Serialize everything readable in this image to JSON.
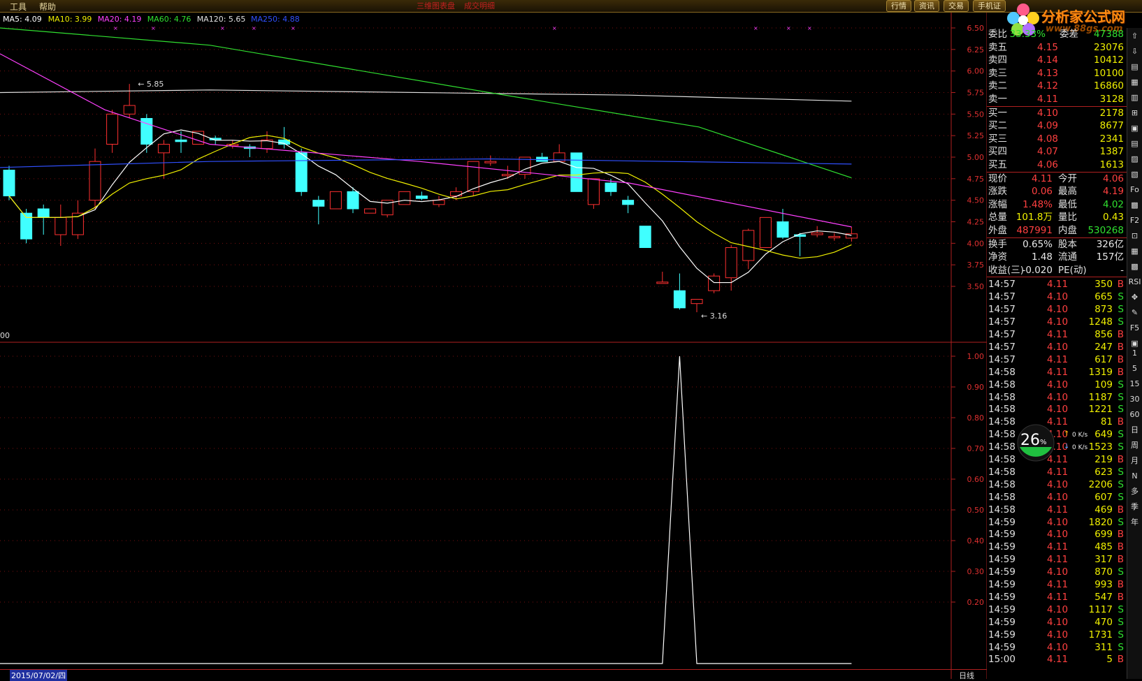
{
  "menu": {
    "tools": "工具",
    "help": "帮助",
    "red1": "三维图表盘",
    "red2": "成交明细"
  },
  "top_buttons": [
    "行情",
    "资讯",
    "交易",
    "手机证"
  ],
  "logo": {
    "title": "分析家公式网",
    "url": "www.88gs.com"
  },
  "ma_legend": [
    {
      "label": "MA5: 4.09",
      "color": "#ffffff"
    },
    {
      "label": "MA10: 3.99",
      "color": "#f0f000"
    },
    {
      "label": "MA20: 4.19",
      "color": "#ff40ff"
    },
    {
      "label": "MA60: 4.76",
      "color": "#30e030"
    },
    {
      "label": "MA120: 5.65",
      "color": "#e0e0e0"
    },
    {
      "label": "MA250: 4.88",
      "color": "#3050ff"
    }
  ],
  "price_axis": [
    "6.50",
    "6.25",
    "6.00",
    "5.75",
    "5.50",
    "5.25",
    "5.00",
    "4.75",
    "4.50",
    "4.25",
    "4.00",
    "3.75",
    "3.50"
  ],
  "indicator_axis": [
    "1.00",
    "0.90",
    "0.80",
    "0.70",
    "0.60",
    "0.50",
    "0.40",
    "0.30",
    "0.20"
  ],
  "indicator_label": "00",
  "annotations": {
    "high": "5.85",
    "low": "3.16"
  },
  "candles": [
    {
      "o": 4.85,
      "c": 4.55,
      "h": 4.9,
      "l": 4.5
    },
    {
      "o": 4.35,
      "c": 4.05,
      "h": 4.4,
      "l": 4.0
    },
    {
      "o": 4.4,
      "c": 4.3,
      "h": 4.45,
      "l": 4.1
    },
    {
      "o": 4.1,
      "c": 4.3,
      "h": 4.45,
      "l": 3.97
    },
    {
      "o": 4.1,
      "c": 4.35,
      "h": 4.5,
      "l": 4.05
    },
    {
      "o": 4.5,
      "c": 4.95,
      "h": 5.1,
      "l": 4.4
    },
    {
      "o": 5.15,
      "c": 5.5,
      "h": 5.55,
      "l": 5.05
    },
    {
      "o": 5.5,
      "c": 5.6,
      "h": 5.85,
      "l": 5.45
    },
    {
      "o": 5.45,
      "c": 5.15,
      "h": 5.5,
      "l": 5.05
    },
    {
      "o": 5.05,
      "c": 5.15,
      "h": 5.2,
      "l": 4.75
    },
    {
      "o": 5.2,
      "c": 5.18,
      "h": 5.3,
      "l": 5.05
    },
    {
      "o": 5.15,
      "c": 5.3,
      "h": 5.3,
      "l": 5.15
    },
    {
      "o": 5.22,
      "c": 5.2,
      "h": 5.25,
      "l": 5.15
    },
    {
      "o": 5.15,
      "c": 5.15,
      "h": 5.2,
      "l": 5.1
    },
    {
      "o": 5.12,
      "c": 5.1,
      "h": 5.15,
      "l": 5.0
    },
    {
      "o": 5.1,
      "c": 5.2,
      "h": 5.3,
      "l": 5.05
    },
    {
      "o": 5.2,
      "c": 5.15,
      "h": 5.35,
      "l": 5.1
    },
    {
      "o": 5.05,
      "c": 4.6,
      "h": 5.1,
      "l": 4.55
    },
    {
      "o": 4.5,
      "c": 4.43,
      "h": 4.55,
      "l": 4.22
    },
    {
      "o": 4.4,
      "c": 4.6,
      "h": 4.6,
      "l": 4.4
    },
    {
      "o": 4.6,
      "c": 4.4,
      "h": 4.65,
      "l": 4.35
    },
    {
      "o": 4.35,
      "c": 4.4,
      "h": 4.4,
      "l": 4.35
    },
    {
      "o": 4.33,
      "c": 4.5,
      "h": 4.5,
      "l": 4.3
    },
    {
      "o": 4.45,
      "c": 4.6,
      "h": 4.6,
      "l": 4.45
    },
    {
      "o": 4.55,
      "c": 4.52,
      "h": 4.6,
      "l": 4.5
    },
    {
      "o": 4.45,
      "c": 4.5,
      "h": 4.55,
      "l": 4.42
    },
    {
      "o": 4.55,
      "c": 4.6,
      "h": 4.65,
      "l": 4.5
    },
    {
      "o": 4.6,
      "c": 4.95,
      "h": 4.95,
      "l": 4.55
    },
    {
      "o": 4.95,
      "c": 4.95,
      "h": 5.02,
      "l": 4.9
    },
    {
      "o": 4.8,
      "c": 4.8,
      "h": 4.9,
      "l": 4.75
    },
    {
      "o": 4.8,
      "c": 5.0,
      "h": 5.0,
      "l": 4.75
    },
    {
      "o": 5.0,
      "c": 4.95,
      "h": 5.05,
      "l": 4.95
    },
    {
      "o": 4.95,
      "c": 5.05,
      "h": 5.15,
      "l": 4.95
    },
    {
      "o": 5.05,
      "c": 4.6,
      "h": 5.05,
      "l": 4.6
    },
    {
      "o": 4.45,
      "c": 4.75,
      "h": 4.75,
      "l": 4.4
    },
    {
      "o": 4.7,
      "c": 4.6,
      "h": 4.75,
      "l": 4.55
    },
    {
      "o": 4.5,
      "c": 4.45,
      "h": 4.55,
      "l": 4.35
    },
    {
      "o": 4.2,
      "c": 3.95,
      "h": 4.2,
      "l": 3.95
    },
    {
      "o": 3.55,
      "c": 3.55,
      "h": 3.67,
      "l": 3.55
    },
    {
      "o": 3.45,
      "c": 3.25,
      "h": 3.65,
      "l": 3.23
    },
    {
      "o": 3.3,
      "c": 3.35,
      "h": 3.35,
      "l": 3.2
    },
    {
      "o": 3.45,
      "c": 3.62,
      "h": 3.65,
      "l": 3.42
    },
    {
      "o": 3.6,
      "c": 3.95,
      "h": 3.98,
      "l": 3.45
    },
    {
      "o": 3.8,
      "c": 4.15,
      "h": 4.17,
      "l": 3.7
    },
    {
      "o": 3.95,
      "c": 4.3,
      "h": 4.3,
      "l": 3.95
    },
    {
      "o": 4.25,
      "c": 4.07,
      "h": 4.4,
      "l": 4.05
    },
    {
      "o": 4.1,
      "c": 4.08,
      "h": 4.12,
      "l": 3.85
    },
    {
      "o": 4.1,
      "c": 4.12,
      "h": 4.2,
      "l": 4.07
    },
    {
      "o": 4.08,
      "c": 4.08,
      "h": 4.12,
      "l": 4.03
    },
    {
      "o": 4.06,
      "c": 4.11,
      "h": 4.19,
      "l": 4.02
    }
  ],
  "indicator_series": {
    "zero_before": 38,
    "spike_index": 39,
    "value": 1.0
  },
  "quote": {
    "committee": {
      "label1": "委比",
      "value1": "33.33%",
      "label2": "委差",
      "value2": "47388"
    },
    "sells": [
      {
        "label": "卖五",
        "price": "4.15",
        "vol": "23076"
      },
      {
        "label": "卖四",
        "price": "4.14",
        "vol": "10412"
      },
      {
        "label": "卖三",
        "price": "4.13",
        "vol": "10100"
      },
      {
        "label": "卖二",
        "price": "4.12",
        "vol": "16860"
      },
      {
        "label": "卖一",
        "price": "4.11",
        "vol": "3128"
      }
    ],
    "buys": [
      {
        "label": "买一",
        "price": "4.10",
        "vol": "2178"
      },
      {
        "label": "买二",
        "price": "4.09",
        "vol": "8677"
      },
      {
        "label": "买三",
        "price": "4.08",
        "vol": "2341"
      },
      {
        "label": "买四",
        "price": "4.07",
        "vol": "1387"
      },
      {
        "label": "买五",
        "price": "4.06",
        "vol": "1613"
      }
    ],
    "stats": [
      {
        "l1": "现价",
        "v1": "4.11",
        "c1": "red",
        "l2": "今开",
        "v2": "4.06",
        "c2": "red"
      },
      {
        "l1": "涨跌",
        "v1": "0.06",
        "c1": "red",
        "l2": "最高",
        "v2": "4.19",
        "c2": "red"
      },
      {
        "l1": "涨幅",
        "v1": "1.48%",
        "c1": "red",
        "l2": "最低",
        "v2": "4.02",
        "c2": "green"
      },
      {
        "l1": "总量",
        "v1": "101.8万",
        "c1": "yellow",
        "l2": "量比",
        "v2": "0.43",
        "c2": "yellow"
      },
      {
        "l1": "外盘",
        "v1": "487991",
        "c1": "red",
        "l2": "内盘",
        "v2": "530268",
        "c2": "green"
      }
    ],
    "stats2": [
      {
        "l1": "换手",
        "v1": "0.65%",
        "l2": "股本",
        "v2": "326亿"
      },
      {
        "l1": "净资",
        "v1": "1.48",
        "l2": "流通",
        "v2": "157亿"
      },
      {
        "l1": "收益(三)",
        "v1": "-0.020",
        "l2": "PE(动)",
        "v2": "-"
      }
    ]
  },
  "ticks": [
    [
      "14:57",
      "4.11",
      "350",
      "B"
    ],
    [
      "14:57",
      "4.10",
      "665",
      "S"
    ],
    [
      "14:57",
      "4.10",
      "873",
      "S"
    ],
    [
      "14:57",
      "4.10",
      "1248",
      "S"
    ],
    [
      "14:57",
      "4.11",
      "856",
      "B"
    ],
    [
      "14:57",
      "4.10",
      "247",
      "B"
    ],
    [
      "14:57",
      "4.11",
      "617",
      "B"
    ],
    [
      "14:58",
      "4.11",
      "1319",
      "B"
    ],
    [
      "14:58",
      "4.10",
      "109",
      "S"
    ],
    [
      "14:58",
      "4.10",
      "1187",
      "S"
    ],
    [
      "14:58",
      "4.10",
      "1221",
      "S"
    ],
    [
      "14:58",
      "4.11",
      "81",
      "B"
    ],
    [
      "14:58",
      "4.10",
      "649",
      "S"
    ],
    [
      "14:58",
      "4.10",
      "1523",
      "S"
    ],
    [
      "14:58",
      "4.11",
      "219",
      "B"
    ],
    [
      "14:58",
      "4.11",
      "623",
      "S"
    ],
    [
      "14:58",
      "4.10",
      "2206",
      "S"
    ],
    [
      "14:58",
      "4.10",
      "607",
      "S"
    ],
    [
      "14:58",
      "4.11",
      "469",
      "B"
    ],
    [
      "14:59",
      "4.10",
      "1820",
      "S"
    ],
    [
      "14:59",
      "4.10",
      "699",
      "B"
    ],
    [
      "14:59",
      "4.11",
      "485",
      "B"
    ],
    [
      "14:59",
      "4.11",
      "317",
      "B"
    ],
    [
      "14:59",
      "4.10",
      "870",
      "S"
    ],
    [
      "14:59",
      "4.11",
      "993",
      "B"
    ],
    [
      "14:59",
      "4.11",
      "547",
      "B"
    ],
    [
      "14:59",
      "4.10",
      "1117",
      "S"
    ],
    [
      "14:59",
      "4.10",
      "470",
      "S"
    ],
    [
      "14:59",
      "4.10",
      "1731",
      "S"
    ],
    [
      "14:59",
      "4.10",
      "311",
      "S"
    ],
    [
      "15:00",
      "4.11",
      "5",
      "B"
    ]
  ],
  "net": {
    "percent": "26",
    "unit": "%",
    "up": "0 K/s",
    "down": "0 K/s"
  },
  "date_label": "2015/07/02/四",
  "period_label": "日线",
  "period_buttons": [
    "1",
    "5",
    "15",
    "30",
    "60",
    "日",
    "周",
    "月",
    "N",
    "多",
    "季",
    "年"
  ],
  "colors": {
    "up": "#ff3030",
    "down": "#40ffff",
    "frame": "#b02020",
    "ma5": "#ffffff",
    "ma10": "#f0f000",
    "ma20": "#ff40ff",
    "ma60": "#30e030",
    "ma120": "#e0e0e0",
    "ma250": "#3050ff"
  }
}
